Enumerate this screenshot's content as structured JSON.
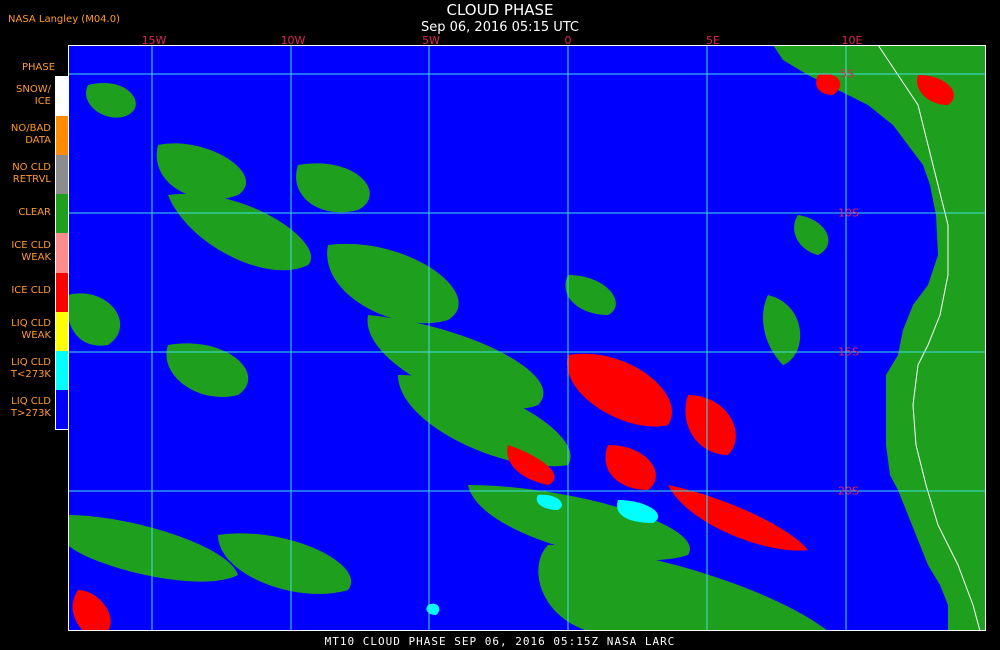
{
  "header": {
    "title": "CLOUD PHASE",
    "subtitle": "Sep 06, 2016 05:15 UTC",
    "producer": "NASA Langley (M04.0)"
  },
  "legend": {
    "title": "PHASE",
    "items": [
      {
        "label": "SNOW/\nICE",
        "color": "#ffffff"
      },
      {
        "label": "NO/BAD\nDATA",
        "color": "#ff8c00"
      },
      {
        "label": "NO CLD\nRETRVL",
        "color": "#8c8c8c"
      },
      {
        "label": "CLEAR",
        "color": "#1ea01e"
      },
      {
        "label": "ICE CLD\nWEAK",
        "color": "#ff8c8c"
      },
      {
        "label": "ICE CLD",
        "color": "#ff0000"
      },
      {
        "label": "LIQ CLD\nWEAK",
        "color": "#ffff00"
      },
      {
        "label": "LIQ CLD\nT<273K",
        "color": "#00ffff"
      },
      {
        "label": "LIQ CLD\nT>273K",
        "color": "#0000ff"
      }
    ]
  },
  "map": {
    "ocean_color": "#0000ff",
    "land_color": "#1ea01e",
    "grid_color": "#40e0e0",
    "lon_labels": [
      "15W",
      "10W",
      "5W",
      "0",
      "5E",
      "10E"
    ],
    "lat_labels": [
      "5S",
      "10S",
      "15S",
      "20S"
    ]
  },
  "footer": {
    "text": "MT10  CLOUD PHASE  SEP 06, 2016 05:15Z  NASA LARC"
  }
}
